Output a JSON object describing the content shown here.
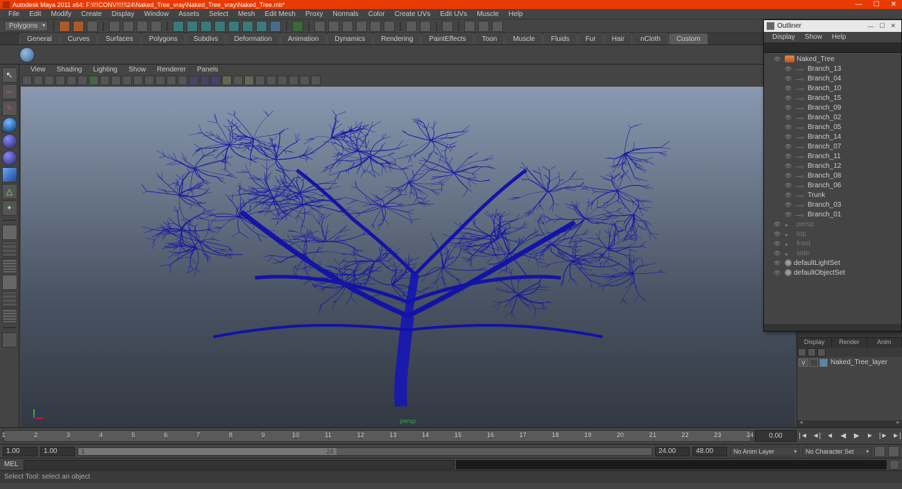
{
  "titlebar": {
    "text": "Autodesk Maya 2011 x64: F:\\!!!CONV!!!!!\\24\\Naked_Tree_vray\\Naked_Tree_vray\\Naked_Tree.mb*",
    "min": "—",
    "max": "☐",
    "close": "✕"
  },
  "mainmenu": [
    "File",
    "Edit",
    "Modify",
    "Create",
    "Display",
    "Window",
    "Assets",
    "Select",
    "Mesh",
    "Edit Mesh",
    "Proxy",
    "Normals",
    "Color",
    "Create UVs",
    "Edit UVs",
    "Muscle",
    "Help"
  ],
  "statusbar": {
    "menuset": "Polygons"
  },
  "shelftabs": [
    "General",
    "Curves",
    "Surfaces",
    "Polygons",
    "Subdivs",
    "Deformation",
    "Animation",
    "Dynamics",
    "Rendering",
    "PaintEffects",
    "Toon",
    "Muscle",
    "Fluids",
    "Fur",
    "Hair",
    "nCloth",
    "Custom"
  ],
  "shelftab_selected": "Custom",
  "vpmenu": [
    "View",
    "Shading",
    "Lighting",
    "Show",
    "Renderer",
    "Panels"
  ],
  "viewport": {
    "camera": "persp"
  },
  "outliner": {
    "title": "Outliner",
    "menu": [
      "Display",
      "Show",
      "Help"
    ],
    "root": "Naked_Tree",
    "children": [
      "Branch_13",
      "Branch_04",
      "Branch_10",
      "Branch_15",
      "Branch_09",
      "Branch_02",
      "Branch_05",
      "Branch_14",
      "Branch_07",
      "Branch_11",
      "Branch_12",
      "Branch_08",
      "Branch_06",
      "Trunk",
      "Branch_03",
      "Branch_01"
    ],
    "cameras": [
      "persp",
      "top",
      "front",
      "side"
    ],
    "sets": [
      "defaultLightSet",
      "defaultObjectSet"
    ]
  },
  "layers": {
    "vis": "V",
    "name": "Naked_Tree_layer"
  },
  "timeslider": {
    "ticks": [
      1,
      2,
      3,
      4,
      5,
      6,
      7,
      8,
      9,
      10,
      11,
      12,
      13,
      14,
      15,
      16,
      17,
      18,
      19,
      20,
      21,
      22,
      23,
      24
    ],
    "current": "0.00"
  },
  "range": {
    "start1": "1.00",
    "start2": "1.00",
    "bar_start": "1",
    "bar_end": "24",
    "end1": "24.00",
    "end2": "48.00",
    "animlayer": "No Anim Layer",
    "charset": "No Character Set"
  },
  "cmd": {
    "label": "MEL"
  },
  "help": {
    "text": "Select Tool: select an object"
  }
}
